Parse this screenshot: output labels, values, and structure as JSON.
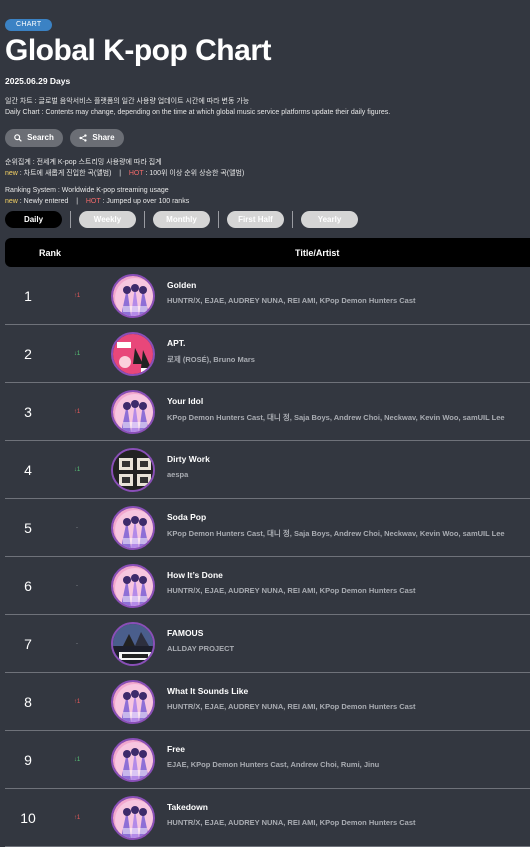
{
  "badge": "CHART",
  "title": "Global K-pop Chart",
  "date": "2025.06.29 Days",
  "desc_ko": "일간 차트 : 글로벌 음악서비스 플랫폼의 일간 사용량 업데이트 시간에 따라 변동 가능",
  "desc_en": "Daily Chart : Contents may change, depending on the time at which global music service platforms update their daily figures.",
  "buttons": {
    "search": "Search",
    "share": "Share"
  },
  "ranking_ko": {
    "line1": "순위집계 : 전세계 K-pop 스트리밍 사용량에 따라 집계",
    "new_label": "new",
    "new_text": " : 차트에 새롭게 진입한 곡(앨범)",
    "sep": "|",
    "hot_label": "HOT",
    "hot_text": " : 100위 이상 순위 상승한 곡(앨범)"
  },
  "ranking_en": {
    "line1": "Ranking System : Worldwide K-pop streaming usage",
    "new_label": "new",
    "new_text": " : Newly entered",
    "sep": "|",
    "hot_label": "HOT",
    "hot_text": " : Jumped up over 100 ranks"
  },
  "tabs": [
    "Daily",
    "Weekly",
    "Monthly",
    "First Half",
    "Yearly"
  ],
  "active_tab": "Daily",
  "table_header": {
    "rank": "Rank",
    "title": "Title/Artist"
  },
  "rows": [
    {
      "rank": "1",
      "change": "↑1",
      "dir": "up",
      "title": "Golden",
      "artist": "HUNTR/X, EJAE, AUDREY NUNA, REI AMI, KPop Demon Hunters Cast",
      "art": "kpop-demon-hunters"
    },
    {
      "rank": "2",
      "change": "↓1",
      "dir": "down",
      "title": "APT.",
      "artist": "로제 (ROSÉ), Bruno Mars",
      "art": "apt"
    },
    {
      "rank": "3",
      "change": "↑1",
      "dir": "up",
      "title": "Your Idol",
      "artist": "KPop Demon Hunters Cast, 대니 정, Saja Boys, Andrew Choi, Neckwav, Kevin Woo, samUIL Lee",
      "art": "kpop-demon-hunters"
    },
    {
      "rank": "4",
      "change": "↓1",
      "dir": "down",
      "title": "Dirty Work",
      "artist": "aespa",
      "art": "dirty-work"
    },
    {
      "rank": "5",
      "change": "-",
      "dir": "same",
      "title": "Soda Pop",
      "artist": "KPop Demon Hunters Cast, 대니 정, Saja Boys, Andrew Choi, Neckwav, Kevin Woo, samUIL Lee",
      "art": "kpop-demon-hunters"
    },
    {
      "rank": "6",
      "change": "-",
      "dir": "same",
      "title": "How It’s Done",
      "artist": "HUNTR/X, EJAE, AUDREY NUNA, REI AMI, KPop Demon Hunters Cast",
      "art": "kpop-demon-hunters"
    },
    {
      "rank": "7",
      "change": "-",
      "dir": "same",
      "title": "FAMOUS",
      "artist": "ALLDAY PROJECT",
      "art": "famous"
    },
    {
      "rank": "8",
      "change": "↑1",
      "dir": "up",
      "title": "What It Sounds Like",
      "artist": "HUNTR/X, EJAE, AUDREY NUNA, REI AMI, KPop Demon Hunters Cast",
      "art": "kpop-demon-hunters"
    },
    {
      "rank": "9",
      "change": "↓1",
      "dir": "down",
      "title": "Free",
      "artist": "EJAE, KPop Demon Hunters Cast, Andrew Choi, Rumi, Jinu",
      "art": "kpop-demon-hunters"
    },
    {
      "rank": "10",
      "change": "↑1",
      "dir": "up",
      "title": "Takedown",
      "artist": "HUNTR/X, EJAE, AUDREY NUNA, REI AMI, KPop Demon Hunters Cast",
      "art": "kpop-demon-hunters"
    }
  ],
  "colors": {
    "background": "#333740",
    "badge": "#3b82c4",
    "up": "#e85a5a",
    "down": "#58c777",
    "new": "#f6d365",
    "hot": "#f26a6a"
  }
}
